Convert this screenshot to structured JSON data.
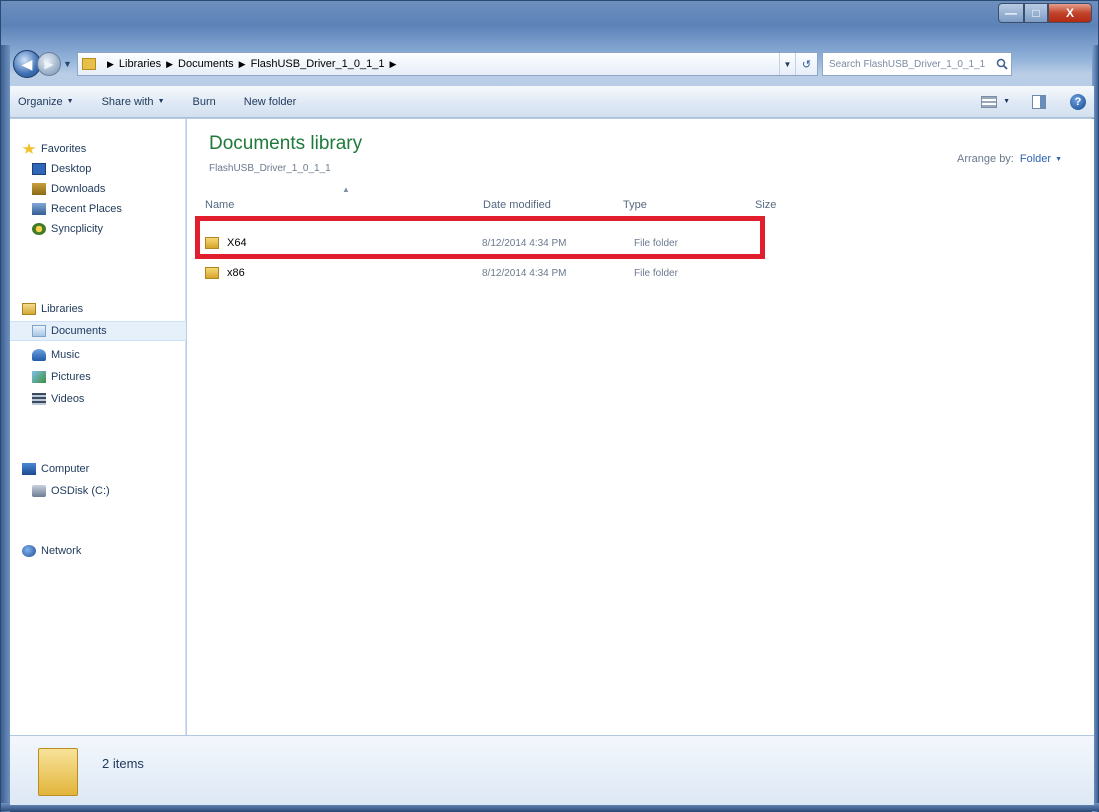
{
  "window": {
    "caption": {
      "minimize": "—",
      "maximize": "□",
      "close": "X"
    }
  },
  "address": {
    "breadcrumbs": [
      "Libraries",
      "Documents",
      "FlashUSB_Driver_1_0_1_1"
    ],
    "search_placeholder": "Search FlashUSB_Driver_1_0_1_1"
  },
  "toolbar": {
    "organize": "Organize",
    "share_with": "Share with",
    "burn": "Burn",
    "new_folder": "New folder",
    "help": "?"
  },
  "nav": {
    "favorites": "Favorites",
    "desktop": "Desktop",
    "downloads": "Downloads",
    "recent": "Recent Places",
    "sync": "Syncplicity",
    "libraries": "Libraries",
    "documents": "Documents",
    "music": "Music",
    "pictures": "Pictures",
    "videos": "Videos",
    "computer": "Computer",
    "osdisk": "OSDisk (C:)",
    "network": "Network"
  },
  "content": {
    "title": "Documents library",
    "subtitle": "FlashUSB_Driver_1_0_1_1",
    "arrange_label": "Arrange by:",
    "arrange_value": "Folder",
    "columns": {
      "name": "Name",
      "date": "Date modified",
      "type": "Type",
      "size": "Size"
    },
    "rows": [
      {
        "name": "X64",
        "date": "8/12/2014 4:34 PM",
        "type": "File folder"
      },
      {
        "name": "x86",
        "date": "8/12/2014 4:34 PM",
        "type": "File folder"
      }
    ]
  },
  "details": {
    "count": "2 items"
  },
  "colors": {
    "highlight": "#e01e2e",
    "title_green": "#1e7a3a",
    "accent": "#2c64b0"
  }
}
